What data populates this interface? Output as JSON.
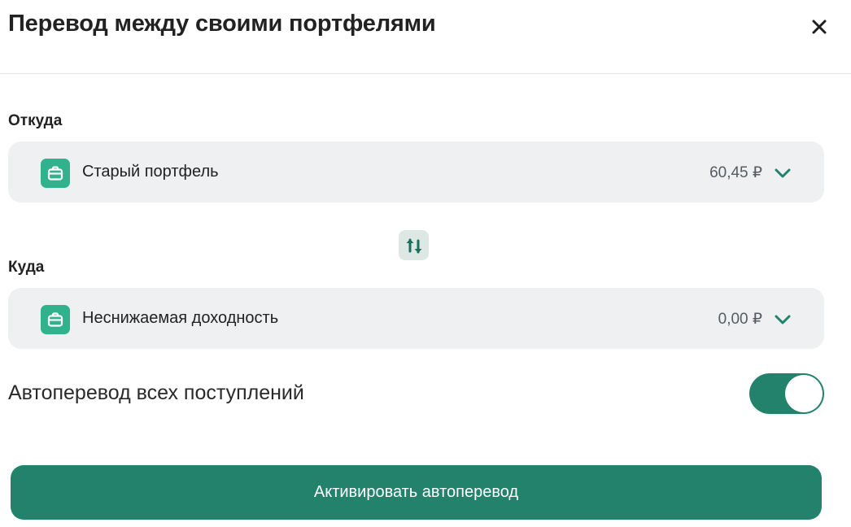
{
  "dialog": {
    "title": "Перевод между своими портфелями",
    "close_icon": "close-icon"
  },
  "from": {
    "label": "Откуда",
    "portfolio_name": "Старый портфель",
    "amount": "60,45 ₽",
    "icon": "briefcase-icon"
  },
  "swap": {
    "icon": "swap-arrows-icon"
  },
  "to": {
    "label": "Куда",
    "portfolio_name": "Неснижаемая доходность",
    "amount": "0,00 ₽",
    "icon": "briefcase-icon"
  },
  "auto_transfer": {
    "label": "Автоперевод всех поступлений",
    "enabled": true
  },
  "actions": {
    "activate_label": "Активировать автоперевод"
  },
  "colors": {
    "accent": "#22826c",
    "icon_green": "#30b38c",
    "field_bg": "#eef0f1"
  }
}
